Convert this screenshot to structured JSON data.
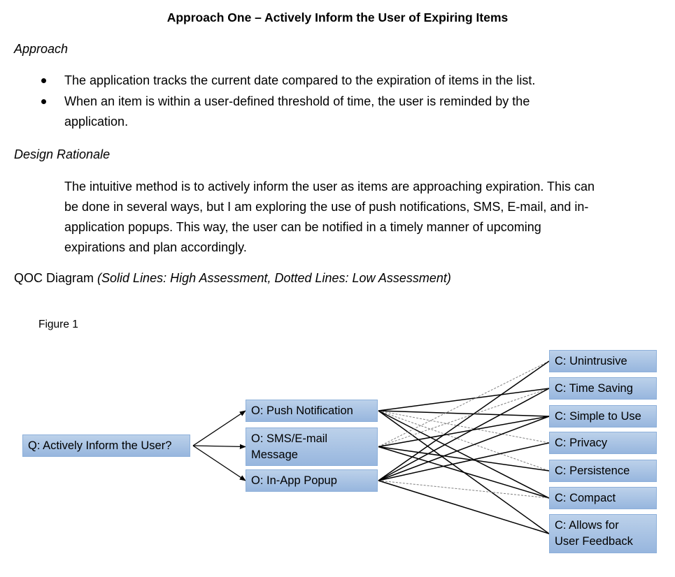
{
  "document": {
    "title": "Approach One – Actively Inform the User of Expiring Items",
    "approach_heading": "Approach",
    "bullets": [
      {
        "lines": [
          "The application tracks the current date compared to the expiration of items in the list."
        ]
      },
      {
        "lines": [
          "When an item is within a user-defined threshold of time, the user is reminded by the",
          "application."
        ]
      }
    ],
    "rationale_heading": "Design Rationale",
    "rationale_lines": [
      "The intuitive method is to actively inform the user as items are approaching expiration. This can",
      "be done in several ways, but I am exploring the use of push notifications, SMS, E-mail, and in-",
      "application popups. This way, the user can be notified in a timely manner of upcoming",
      "expirations and plan accordingly."
    ],
    "qoc_label": "QOC Diagram ",
    "qoc_legend": "(Solid Lines: High Assessment, Dotted Lines: Low Assessment)",
    "figure_caption": "Figure 1"
  },
  "diagram": {
    "question": "Q: Actively Inform the User?",
    "options": [
      {
        "id": "push",
        "lines": [
          "O: Push Notification"
        ]
      },
      {
        "id": "sms",
        "lines": [
          "O: SMS/E-mail",
          "Message"
        ]
      },
      {
        "id": "inapp",
        "lines": [
          "O: In-App Popup"
        ]
      }
    ],
    "criteria": [
      {
        "id": "unintrusive",
        "lines": [
          "C: Unintrusive"
        ]
      },
      {
        "id": "timesaving",
        "lines": [
          "C: Time Saving"
        ]
      },
      {
        "id": "simple",
        "lines": [
          "C: Simple to Use"
        ]
      },
      {
        "id": "privacy",
        "lines": [
          "C: Privacy"
        ]
      },
      {
        "id": "persistence",
        "lines": [
          "C: Persistence"
        ]
      },
      {
        "id": "compact",
        "lines": [
          "C: Compact"
        ]
      },
      {
        "id": "feedback",
        "lines": [
          "C: Allows for",
          "User Feedback"
        ]
      }
    ],
    "links": [
      {
        "option": "push",
        "criterion": "timesaving",
        "assessment": "high"
      },
      {
        "option": "push",
        "criterion": "simple",
        "assessment": "high"
      },
      {
        "option": "push",
        "criterion": "privacy",
        "assessment": "low"
      },
      {
        "option": "push",
        "criterion": "persistence",
        "assessment": "low"
      },
      {
        "option": "push",
        "criterion": "compact",
        "assessment": "high"
      },
      {
        "option": "push",
        "criterion": "feedback",
        "assessment": "high"
      },
      {
        "option": "sms",
        "criterion": "unintrusive",
        "assessment": "low"
      },
      {
        "option": "sms",
        "criterion": "timesaving",
        "assessment": "low"
      },
      {
        "option": "sms",
        "criterion": "simple",
        "assessment": "high"
      },
      {
        "option": "sms",
        "criterion": "persistence",
        "assessment": "high"
      },
      {
        "option": "sms",
        "criterion": "compact",
        "assessment": "high"
      },
      {
        "option": "inapp",
        "criterion": "unintrusive",
        "assessment": "high"
      },
      {
        "option": "inapp",
        "criterion": "timesaving",
        "assessment": "high"
      },
      {
        "option": "inapp",
        "criterion": "simple",
        "assessment": "high"
      },
      {
        "option": "inapp",
        "criterion": "privacy",
        "assessment": "high"
      },
      {
        "option": "inapp",
        "criterion": "compact",
        "assessment": "low"
      },
      {
        "option": "inapp",
        "criterion": "feedback",
        "assessment": "high"
      }
    ],
    "line_styles": {
      "high": "solid",
      "low": "dotted"
    },
    "colors": {
      "box_fill_top": "#bcd1ea",
      "box_fill_bottom": "#97b6de",
      "box_border": "#8db0da",
      "high_line": "#000000",
      "low_line": "#808080",
      "arrow": "#000000"
    }
  }
}
